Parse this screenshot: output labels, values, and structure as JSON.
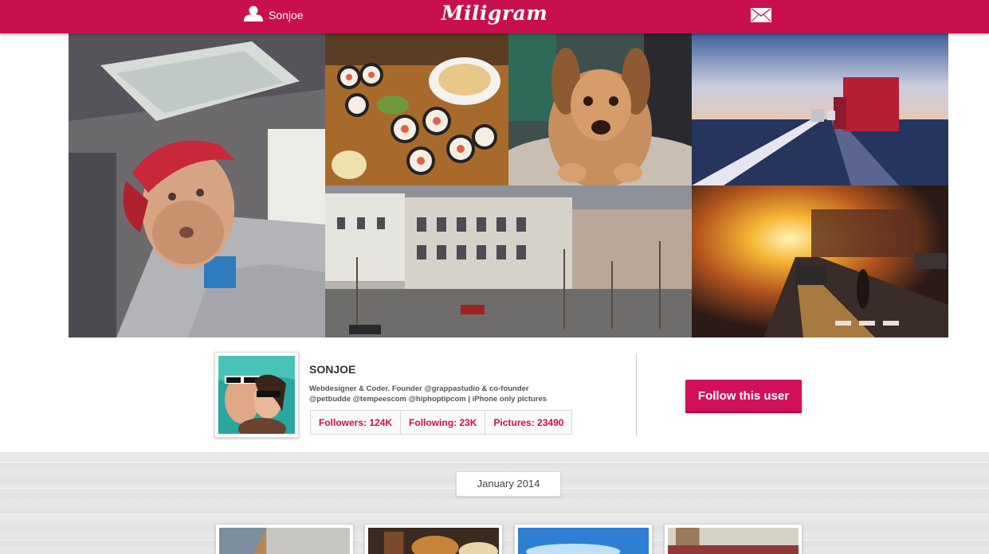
{
  "header": {
    "username": "Sonjoe",
    "logo": "Miligram",
    "user_icon": "user-silhouette-icon",
    "mail_icon": "envelope-icon"
  },
  "hero_photos": [
    {
      "id": "selfie-in-car"
    },
    {
      "id": "sushi"
    },
    {
      "id": "puppy"
    },
    {
      "id": "truck-on-highway"
    },
    {
      "id": "city-building"
    },
    {
      "id": "sunset-street"
    }
  ],
  "profile": {
    "name": "SONJOE",
    "bio_line1": "Webdesigner & Coder. Founder @grappastudio & co-founder",
    "bio_line2": "@petbudde @tempeescom @hiphoptipcom | iPhone only pictures",
    "stats": {
      "followers": "Followers: 124K",
      "following": "Following: 23K",
      "pictures": "Pictures: 23490"
    },
    "follow_label": "Follow this user"
  },
  "timeline": {
    "month": "January 2014"
  },
  "colors": {
    "brand": "#c8104f",
    "button": "#d0115a"
  }
}
